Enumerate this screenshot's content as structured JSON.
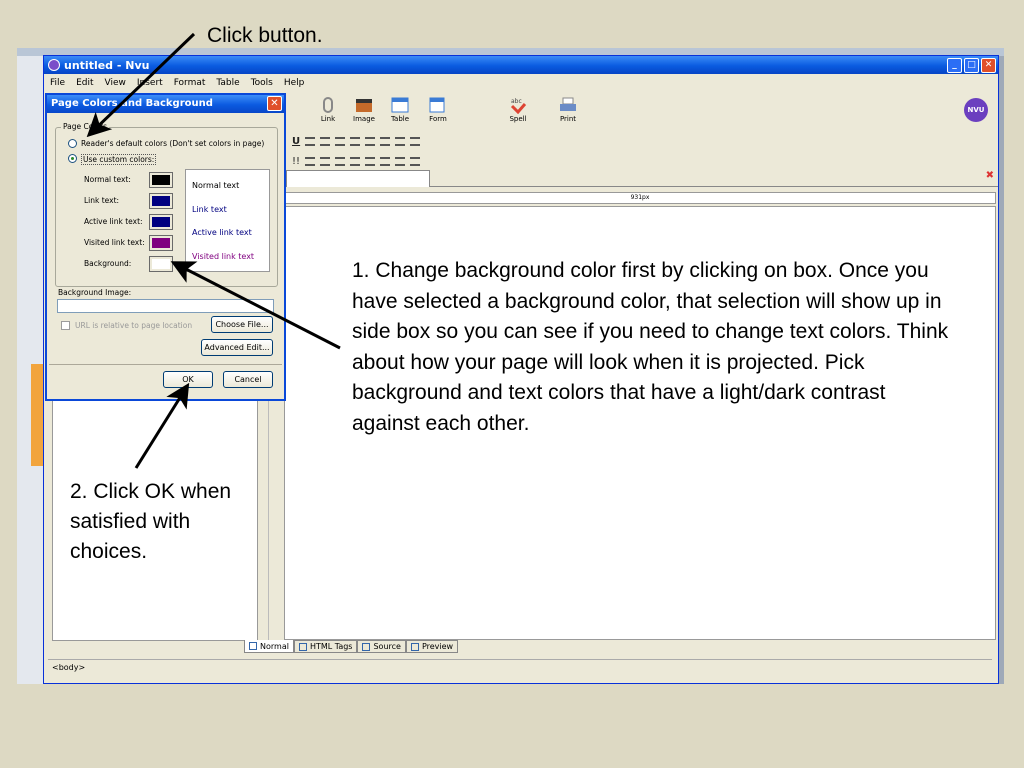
{
  "slide": {
    "top_caption": "Click button.",
    "step1_caption": "1. Change background color first by clicking on box.  Once you have selected a background color, that selection will show up in side box so you can see if you need to change text colors.  Think about how your page will look when it is projected.  Pick background and text colors that have a light/dark contrast against each other.",
    "step2_caption": "2. Click OK when satisfied with choices."
  },
  "window": {
    "title": "untitled - Nvu",
    "menu": [
      "File",
      "Edit",
      "View",
      "Insert",
      "Format",
      "Table",
      "Tools",
      "Help"
    ]
  },
  "toolbar": {
    "buttons": [
      "Link",
      "Image",
      "Table",
      "Form",
      "Spell",
      "Print"
    ],
    "logo": "NVU"
  },
  "ruler": {
    "width_label": "931px"
  },
  "bottom_tabs": [
    "Normal",
    "HTML Tags",
    "Source",
    "Preview"
  ],
  "status": {
    "path": "<body>"
  },
  "dialog": {
    "title": "Page Colors and Background",
    "group_label": "Page Colors",
    "radio_default": "Reader's default colors (Don't set colors in page)",
    "radio_custom": "Use custom colors:",
    "rows": [
      {
        "label": "Normal text:",
        "color": "#000000"
      },
      {
        "label": "Link text:",
        "color": "#000080"
      },
      {
        "label": "Active link text:",
        "color": "#000080"
      },
      {
        "label": "Visited link text:",
        "color": "#800080"
      },
      {
        "label": "Background:",
        "color": "#ffffff"
      }
    ],
    "preview": {
      "normal": "Normal text",
      "link": "Link text",
      "active": "Active link text",
      "visited": "Visited link text"
    },
    "bg_image_label": "Background Image:",
    "url_relative": "URL is relative to page location",
    "choose_file": "Choose File...",
    "advanced_edit": "Advanced Edit...",
    "ok": "OK",
    "cancel": "Cancel"
  },
  "colors": {
    "accent": "#0a5be0",
    "arrow": "#000000",
    "link_preview": "#000080",
    "active_preview": "#000080",
    "visited_preview": "#800080"
  }
}
